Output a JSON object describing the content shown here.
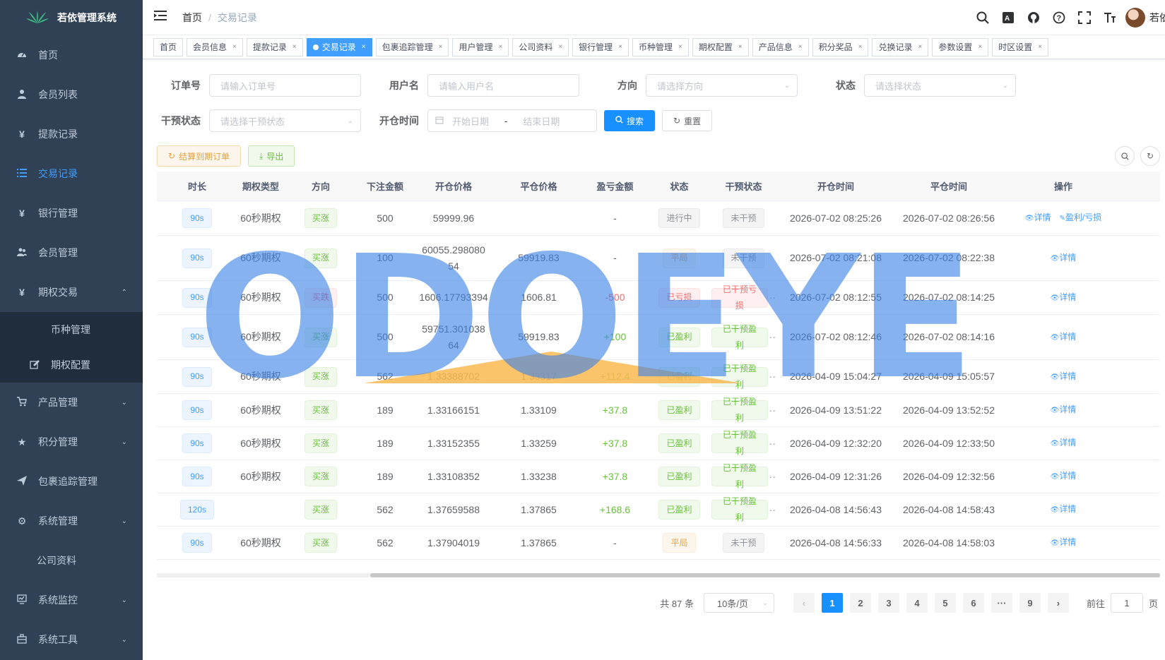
{
  "app": {
    "title": "若依管理系统"
  },
  "sidebar": {
    "items": [
      {
        "label": "首页",
        "icon": "dashboard-icon"
      },
      {
        "label": "会员列表",
        "icon": "user-icon"
      },
      {
        "label": "提款记录",
        "icon": "yen-icon"
      },
      {
        "label": "交易记录",
        "icon": "list-icon",
        "active": true
      },
      {
        "label": "银行管理",
        "icon": "yen-icon"
      },
      {
        "label": "会员管理",
        "icon": "peoples-icon"
      },
      {
        "label": "期权交易",
        "icon": "yen-icon",
        "expanded": true
      }
    ],
    "sub_items": [
      {
        "label": "币种管理"
      },
      {
        "label": "期权配置",
        "icon": "edit-icon"
      }
    ],
    "items_after": [
      {
        "label": "产品管理",
        "icon": "cart-icon"
      },
      {
        "label": "积分管理",
        "icon": "star-icon"
      },
      {
        "label": "包裹追踪管理",
        "icon": "plane-icon"
      },
      {
        "label": "系统管理",
        "icon": "gear-icon"
      },
      {
        "label": "公司资料",
        "icon": ""
      },
      {
        "label": "系统监控",
        "icon": "monitor-icon"
      },
      {
        "label": "系统工具",
        "icon": "toolbox-icon"
      }
    ]
  },
  "navbar": {
    "breadcrumb": [
      "首页",
      "交易记录"
    ],
    "username": "若依"
  },
  "tags": [
    "首页",
    "会员信息",
    "提款记录",
    "交易记录",
    "包裹追踪管理",
    "用户管理",
    "公司资料",
    "银行管理",
    "币种管理",
    "期权配置",
    "产品信息",
    "积分奖品",
    "兑换记录",
    "参数设置",
    "时区设置"
  ],
  "active_tag": "交易记录",
  "filters": {
    "order_no": {
      "label": "订单号",
      "placeholder": "请输入订单号"
    },
    "username": {
      "label": "用户名",
      "placeholder": "请输入用户名"
    },
    "direction": {
      "label": "方向",
      "placeholder": "请选择方向"
    },
    "status": {
      "label": "状态",
      "placeholder": "请选择状态"
    },
    "intervene": {
      "label": "干预状态",
      "placeholder": "请选择干预状态"
    },
    "open_time": {
      "label": "开仓时间",
      "start_placeholder": "开始日期",
      "separator": "-",
      "end_placeholder": "结束日期"
    },
    "search_label": "搜索",
    "reset_label": "重置"
  },
  "toolbar": {
    "settle_label": "结算到期订单",
    "export_label": "导出"
  },
  "table": {
    "headers": [
      "时长",
      "期权类型",
      "方向",
      "下注金额",
      "开仓价格",
      "平仓价格",
      "盈亏金额",
      "状态",
      "干预状态",
      "开仓时间",
      "平仓时间",
      "操作"
    ],
    "rows": [
      {
        "duration": "90s",
        "type": "60秒期权",
        "direction": "买涨",
        "dir_kind": "success",
        "amount": "500",
        "open_price": "59999.96",
        "close_price": "",
        "pnl": "-",
        "pnl_kind": "",
        "status": "进行中",
        "status_kind": "gray",
        "intervene": "未干预",
        "int_kind": "gray",
        "open_time": "2026-07-02 08:25:26",
        "close_time": "2026-07-02 08:26:56",
        "actions": [
          "详情",
          "盈利/亏损"
        ],
        "tall": false
      },
      {
        "duration": "90s",
        "type": "60秒期权",
        "direction": "买涨",
        "dir_kind": "success",
        "amount": "100",
        "open_price": "60055.29808054",
        "close_price": "59919.83",
        "pnl": "-",
        "pnl_kind": "",
        "status": "平局",
        "status_kind": "warn",
        "intervene": "未干预",
        "int_kind": "gray",
        "open_time": "2026-07-02 08:21:08",
        "close_time": "2026-07-02 08:22:38",
        "actions": [
          "详情"
        ],
        "tall": true
      },
      {
        "duration": "90s",
        "type": "60秒期权",
        "direction": "买跌",
        "dir_kind": "danger",
        "amount": "500",
        "open_price": "1606.17793394",
        "close_price": "1606.81",
        "pnl": "-500",
        "pnl_kind": "neg",
        "status": "已亏损",
        "status_kind": "danger",
        "intervene": "已干预亏损",
        "int_kind": "danger",
        "open_time": "2026-07-02 08:12:55",
        "close_time": "2026-07-02 08:14:25",
        "actions": [
          "详情"
        ],
        "tall": false
      },
      {
        "duration": "90s",
        "type": "60秒期权",
        "direction": "买涨",
        "dir_kind": "success",
        "amount": "500",
        "open_price": "59751.30103864",
        "close_price": "59919.83",
        "pnl": "+100",
        "pnl_kind": "pos",
        "status": "已盈利",
        "status_kind": "success",
        "intervene": "已干预盈利",
        "int_kind": "success",
        "open_time": "2026-07-02 08:12:46",
        "close_time": "2026-07-02 08:14:16",
        "actions": [
          "详情"
        ],
        "tall": true
      },
      {
        "duration": "90s",
        "type": "60秒期权",
        "direction": "买涨",
        "dir_kind": "success",
        "amount": "562",
        "open_price": "1.33388702",
        "close_price": "1.33317",
        "pnl": "+112.4",
        "pnl_kind": "pos",
        "status": "已盈利",
        "status_kind": "success",
        "intervene": "已干预盈利",
        "int_kind": "success",
        "open_time": "2026-04-09 15:04:27",
        "close_time": "2026-04-09 15:05:57",
        "actions": [
          "详情"
        ],
        "tall": false
      },
      {
        "duration": "90s",
        "type": "60秒期权",
        "direction": "买涨",
        "dir_kind": "success",
        "amount": "189",
        "open_price": "1.33166151",
        "close_price": "1.33109",
        "pnl": "+37.8",
        "pnl_kind": "pos",
        "status": "已盈利",
        "status_kind": "success",
        "intervene": "已干预盈利",
        "int_kind": "success",
        "open_time": "2026-04-09 13:51:22",
        "close_time": "2026-04-09 13:52:52",
        "actions": [
          "详情"
        ],
        "tall": false
      },
      {
        "duration": "90s",
        "type": "60秒期权",
        "direction": "买涨",
        "dir_kind": "success",
        "amount": "189",
        "open_price": "1.33152355",
        "close_price": "1.33259",
        "pnl": "+37.8",
        "pnl_kind": "pos",
        "status": "已盈利",
        "status_kind": "success",
        "intervene": "已干预盈利",
        "int_kind": "success",
        "open_time": "2026-04-09 12:32:20",
        "close_time": "2026-04-09 12:33:50",
        "actions": [
          "详情"
        ],
        "tall": false
      },
      {
        "duration": "90s",
        "type": "60秒期权",
        "direction": "买涨",
        "dir_kind": "success",
        "amount": "189",
        "open_price": "1.33108352",
        "close_price": "1.33238",
        "pnl": "+37.8",
        "pnl_kind": "pos",
        "status": "已盈利",
        "status_kind": "success",
        "intervene": "已干预盈利",
        "int_kind": "success",
        "open_time": "2026-04-09 12:31:26",
        "close_time": "2026-04-09 12:32:56",
        "actions": [
          "详情"
        ],
        "tall": false
      },
      {
        "duration": "120s",
        "type": "",
        "direction": "买涨",
        "dir_kind": "success",
        "amount": "562",
        "open_price": "1.37659588",
        "close_price": "1.37865",
        "pnl": "+168.6",
        "pnl_kind": "pos",
        "status": "已盈利",
        "status_kind": "success",
        "intervene": "已干预盈利",
        "int_kind": "success",
        "open_time": "2026-04-08 14:56:43",
        "close_time": "2026-04-08 14:58:43",
        "actions": [
          "详情"
        ],
        "tall": false
      },
      {
        "duration": "90s",
        "type": "60秒期权",
        "direction": "买涨",
        "dir_kind": "success",
        "amount": "562",
        "open_price": "1.37904019",
        "close_price": "1.37865",
        "pnl": "-",
        "pnl_kind": "",
        "status": "平局",
        "status_kind": "warn",
        "intervene": "未干预",
        "int_kind": "gray",
        "open_time": "2026-04-08 14:56:33",
        "close_time": "2026-04-08 14:58:03",
        "actions": [
          "详情"
        ],
        "tall": false
      }
    ]
  },
  "pagination": {
    "total_text": "共 87 条",
    "page_size": "10条/页",
    "pages": [
      "1",
      "2",
      "3",
      "4",
      "5",
      "6",
      "···",
      "9"
    ],
    "current": "1",
    "jump_prefix": "前往",
    "jump_value": "1",
    "jump_suffix": "页"
  },
  "watermark": {
    "text": "ODOEYE"
  },
  "colors": {
    "sidebar_bg": "#304156",
    "sidebar_active_text": "#409eff",
    "primary": "#1890ff"
  }
}
